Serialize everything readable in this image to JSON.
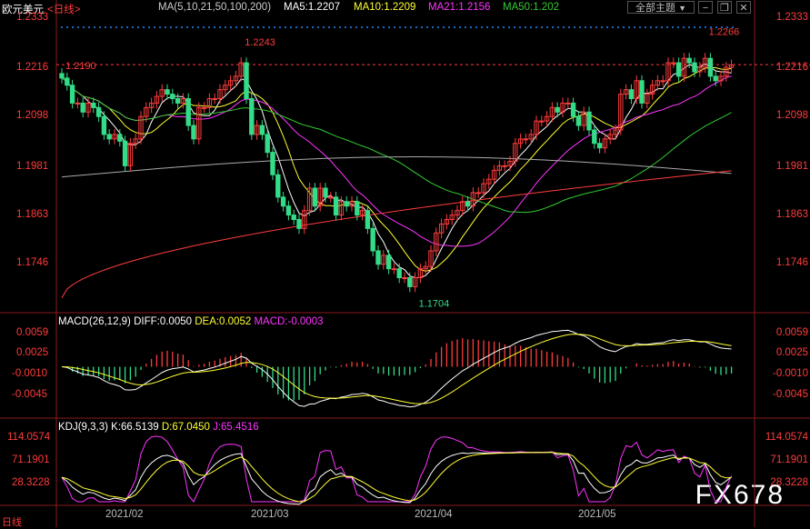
{
  "header": {
    "symbol": "欧元美元",
    "period": "<日线>",
    "ma_text": "MA(5,10,21,50,100,200)",
    "ma5": "MA5:1.2207",
    "ma10": "MA10:1.2209",
    "ma21": "MA21:1.2156",
    "ma50": "MA50:1.202",
    "theme_button": "全部主题",
    "colors": {
      "ma5": "#ffffff",
      "ma10": "#ffff33",
      "ma21": "#ff33ff",
      "ma50": "#33cc33",
      "ma100": "#aaaaaa",
      "ma200": "#ff3c3c"
    }
  },
  "macd": {
    "title": "MACD(26,12,9)",
    "diff": "DIFF:0.0050",
    "dea": "DEA:0.0052",
    "macd": "MACD:-0.0003"
  },
  "kdj": {
    "title": "KDJ(9,3,3)",
    "k": "K:66.5139",
    "d": "D:67.0450",
    "j": "J:65.4516"
  },
  "watermark": "FX678",
  "bottom_tag": "日线",
  "chart_data": [
    {
      "type": "candlestick",
      "title": "欧元美元 日线",
      "x_months": [
        "2021/02",
        "2021/03",
        "2021/04",
        "2021/05"
      ],
      "price_ticks": [
        "1.2333",
        "1.2216",
        "1.2098",
        "1.1981",
        "1.1863",
        "1.1746"
      ],
      "ylim": [
        1.167,
        1.234
      ],
      "annotations": [
        {
          "label": "1.2190",
          "value": 1.219,
          "index": 0
        },
        {
          "label": "1.2243",
          "value": 1.2243,
          "index": 34
        },
        {
          "label": "1.1704",
          "value": 1.1704,
          "index": 67
        },
        {
          "label": "1.2266",
          "value": 1.2266,
          "index": 122
        }
      ],
      "reference_line": 1.2216,
      "closes": [
        1.2186,
        1.217,
        1.213,
        1.213,
        1.211,
        1.213,
        1.212,
        1.21,
        1.206,
        1.205,
        1.206,
        1.2045,
        1.199,
        1.204,
        1.205,
        1.21,
        1.212,
        1.213,
        1.2145,
        1.216,
        1.215,
        1.214,
        1.213,
        1.214,
        1.208,
        1.205,
        1.212,
        1.212,
        1.214,
        1.214,
        1.216,
        1.217,
        1.218,
        1.219,
        1.222,
        1.214,
        1.206,
        1.208,
        1.206,
        1.202,
        1.197,
        1.192,
        1.19,
        1.188,
        1.187,
        1.185,
        1.189,
        1.194,
        1.19,
        1.194,
        1.192,
        1.192,
        1.188,
        1.191,
        1.19,
        1.191,
        1.188,
        1.189,
        1.185,
        1.18,
        1.177,
        1.179,
        1.176,
        1.176,
        1.174,
        1.174,
        1.172,
        1.174,
        1.176,
        1.1765,
        1.18,
        1.184,
        1.186,
        1.187,
        1.188,
        1.189,
        1.191,
        1.19,
        1.193,
        1.193,
        1.195,
        1.196,
        1.198,
        1.199,
        1.199,
        1.2,
        1.204,
        1.205,
        1.205,
        1.206,
        1.209,
        1.209,
        1.21,
        1.212,
        1.211,
        1.213,
        1.213,
        1.21,
        1.208,
        1.211,
        1.207,
        1.204,
        1.203,
        1.205,
        1.206,
        1.207,
        1.215,
        1.216,
        1.214,
        1.218,
        1.213,
        1.215,
        1.217,
        1.218,
        1.218,
        1.222,
        1.222,
        1.219,
        1.223,
        1.222,
        1.22,
        1.221,
        1.223,
        1.219,
        1.218,
        1.219,
        1.221,
        1.2215
      ]
    },
    {
      "type": "bar",
      "title": "MACD(26,12,9)",
      "y_ticks": [
        "0.0059",
        "0.0025",
        "-0.0010",
        "-0.0045"
      ],
      "ylim": [
        -0.0065,
        0.0065
      ],
      "series_names": [
        "DIFF",
        "DEA",
        "MACD"
      ],
      "last": {
        "DIFF": 0.005,
        "DEA": 0.0052,
        "MACD": -0.0003
      }
    },
    {
      "type": "line",
      "title": "KDJ(9,3,3)",
      "y_ticks": [
        "114.0574",
        "71.1901",
        "28.3228"
      ],
      "ylim": [
        10,
        120
      ],
      "series_names": [
        "K",
        "D",
        "J"
      ],
      "last": {
        "K": 66.5139,
        "D": 67.045,
        "J": 65.4516
      }
    }
  ]
}
